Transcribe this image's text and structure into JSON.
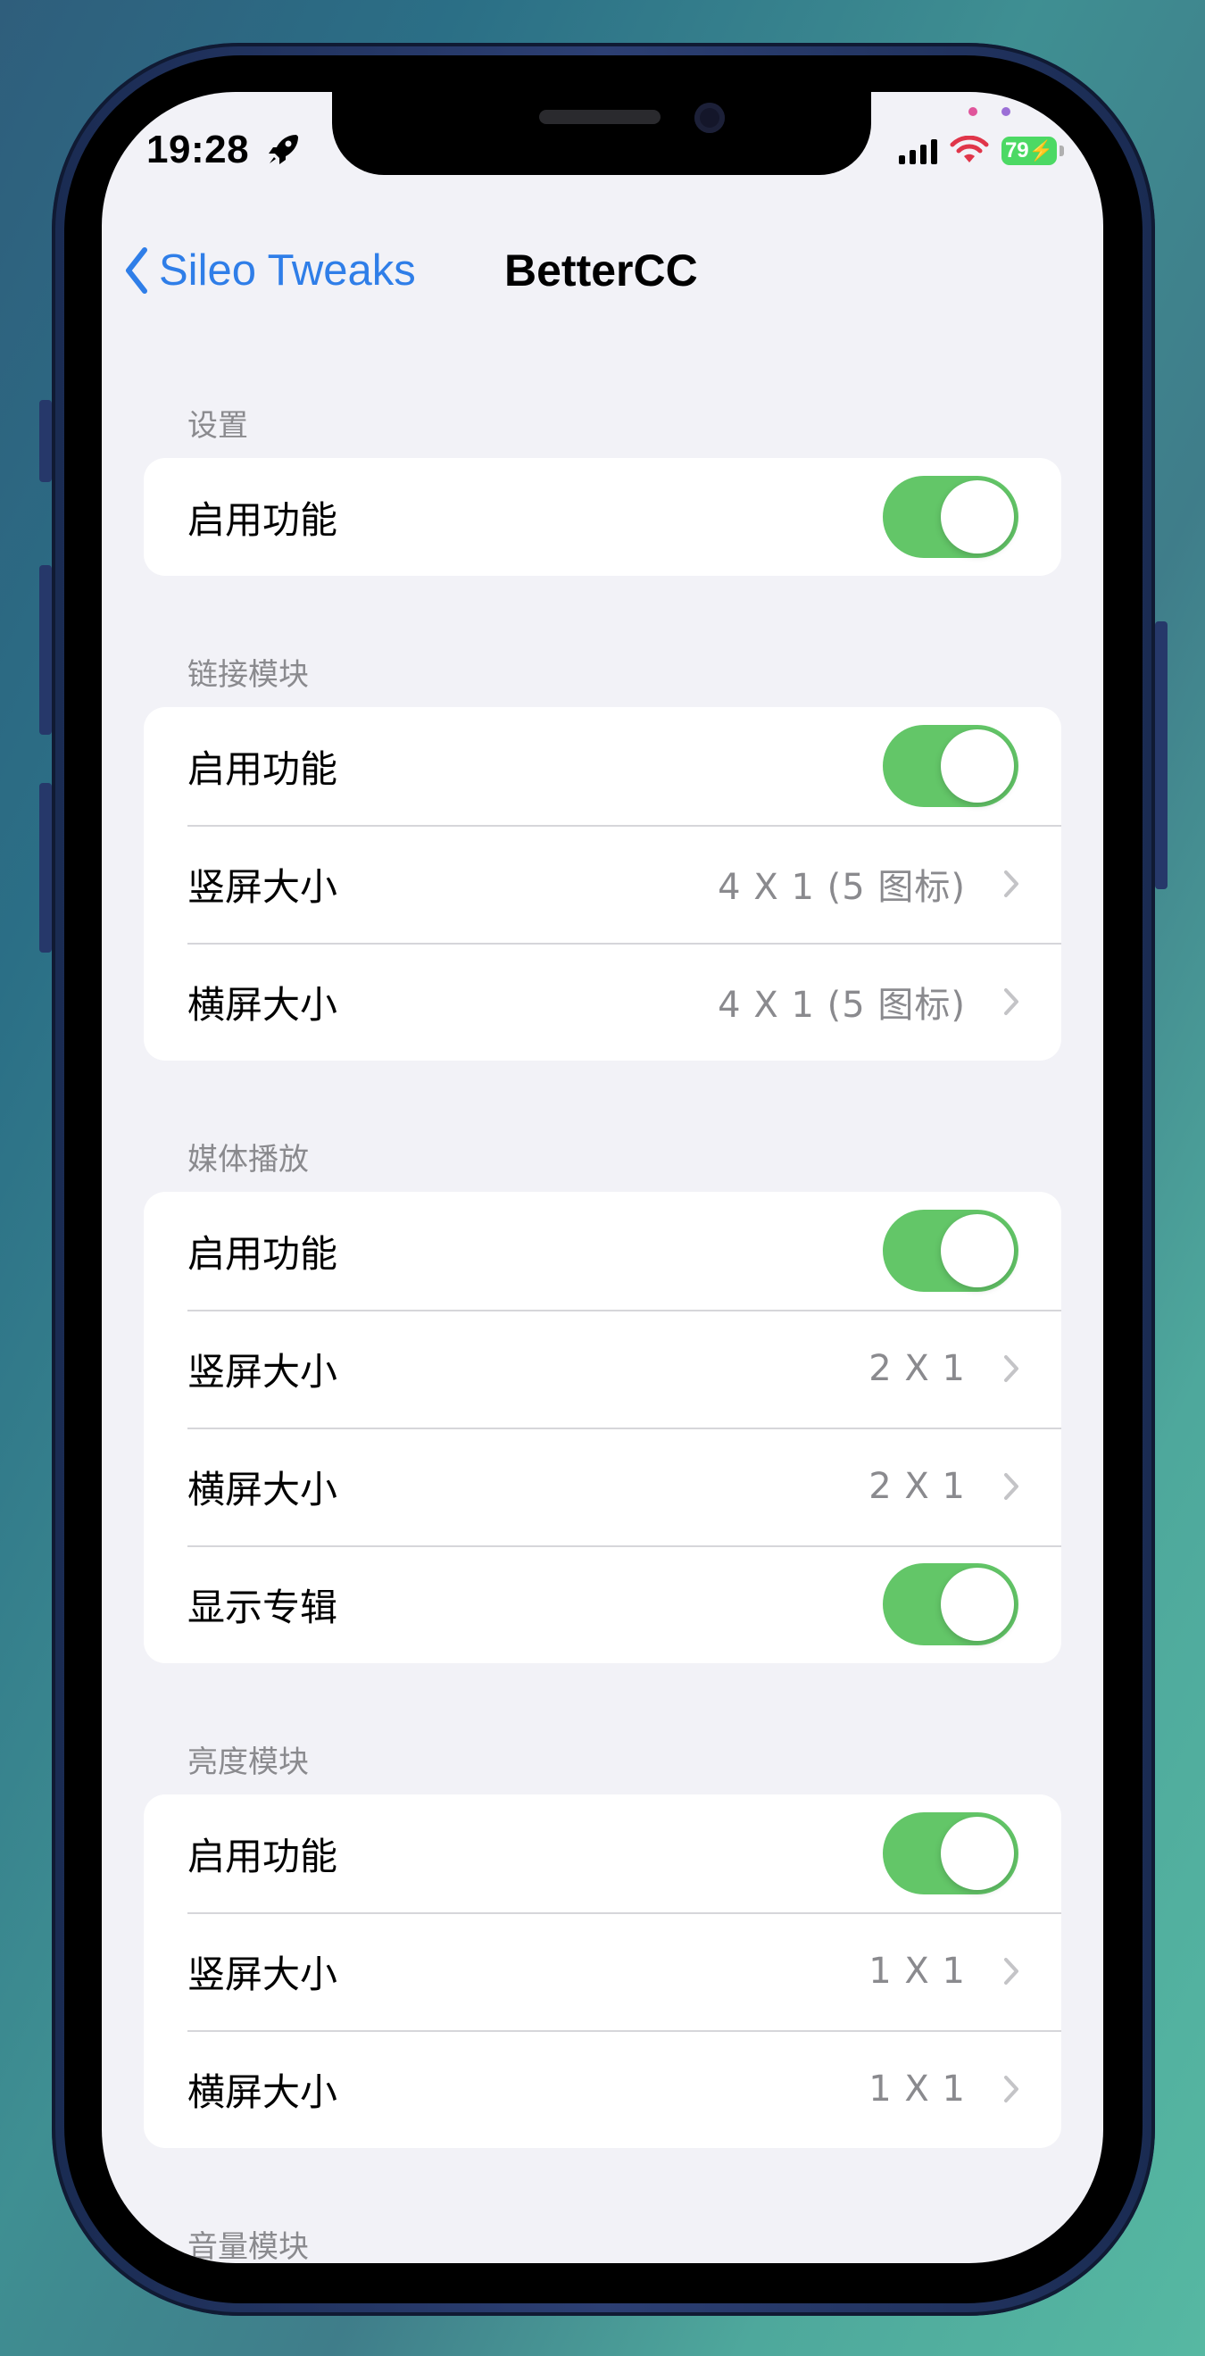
{
  "status_bar": {
    "time": "19:28",
    "battery": "79",
    "icons": [
      "rocket-icon",
      "signal-icon",
      "wifi-icon",
      "battery-charging-icon"
    ]
  },
  "navbar": {
    "back_label": "Sileo Tweaks",
    "title": "BetterCC"
  },
  "sections": [
    {
      "header": "设置",
      "rows": [
        {
          "label": "启用功能",
          "type": "toggle",
          "on": true
        }
      ]
    },
    {
      "header": "链接模块",
      "rows": [
        {
          "label": "启用功能",
          "type": "toggle",
          "on": true
        },
        {
          "label": "竖屏大小",
          "type": "disclosure",
          "value": "4 X 1 (5 图标)"
        },
        {
          "label": "横屏大小",
          "type": "disclosure",
          "value": "4 X 1 (5 图标)"
        }
      ]
    },
    {
      "header": "媒体播放",
      "rows": [
        {
          "label": "启用功能",
          "type": "toggle",
          "on": true
        },
        {
          "label": "竖屏大小",
          "type": "disclosure",
          "value": "2 X 1"
        },
        {
          "label": "横屏大小",
          "type": "disclosure",
          "value": "2 X 1"
        },
        {
          "label": "显示专辑",
          "type": "toggle",
          "on": true
        }
      ]
    },
    {
      "header": "亮度模块",
      "rows": [
        {
          "label": "启用功能",
          "type": "toggle",
          "on": true
        },
        {
          "label": "竖屏大小",
          "type": "disclosure",
          "value": "1 X 1"
        },
        {
          "label": "横屏大小",
          "type": "disclosure",
          "value": "1 X 1"
        }
      ]
    },
    {
      "header": "音量模块",
      "rows": []
    }
  ],
  "colors": {
    "accent": "#2f7ee8",
    "toggle_on": "#63c668",
    "background": "#f2f2f7",
    "secondary_text": "#8a8a8e"
  }
}
